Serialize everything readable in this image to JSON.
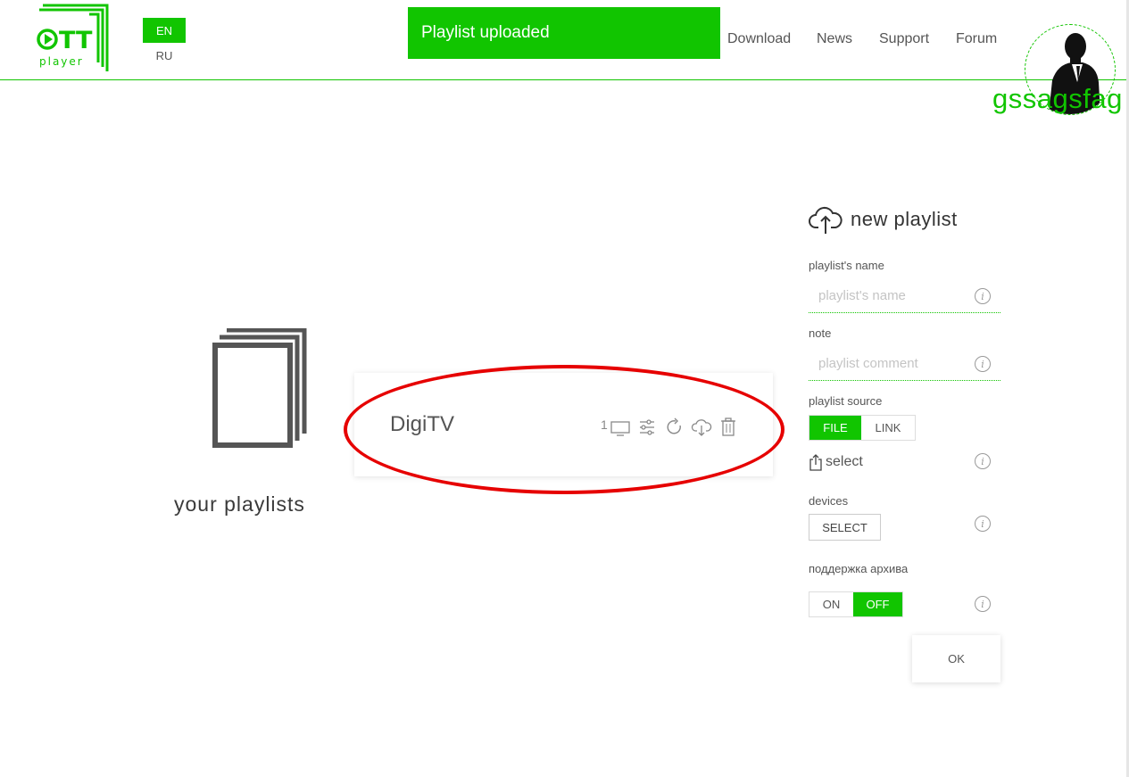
{
  "brand": {
    "logo_text": "OTT",
    "logo_sub": "player",
    "color": "#11c500"
  },
  "languages": {
    "active": "EN",
    "other": "RU"
  },
  "toast": {
    "message": "Playlist uploaded"
  },
  "nav": [
    "Download",
    "News",
    "Support",
    "Forum"
  ],
  "user": {
    "name": "gssagsfag"
  },
  "playlists_section": {
    "label": "your playlists"
  },
  "playlists": [
    {
      "name": "DigiTV",
      "device_count": "1",
      "actions": [
        "tv-icon",
        "settings-sliders-icon",
        "refresh-icon",
        "cloud-download-icon",
        "trash-icon"
      ]
    }
  ],
  "new_playlist": {
    "title": "new playlist",
    "name_label": "playlist's name",
    "name_placeholder": "playlist's name",
    "note_label": "note",
    "note_placeholder": "playlist comment",
    "source_label": "playlist source",
    "source_options": [
      "FILE",
      "LINK"
    ],
    "source_selected": "FILE",
    "select_label": "select",
    "devices_label": "devices",
    "devices_button": "SELECT",
    "archive_label": "поддержка архива",
    "archive_options": [
      "ON",
      "OFF"
    ],
    "archive_selected": "OFF",
    "ok_label": "OK"
  }
}
